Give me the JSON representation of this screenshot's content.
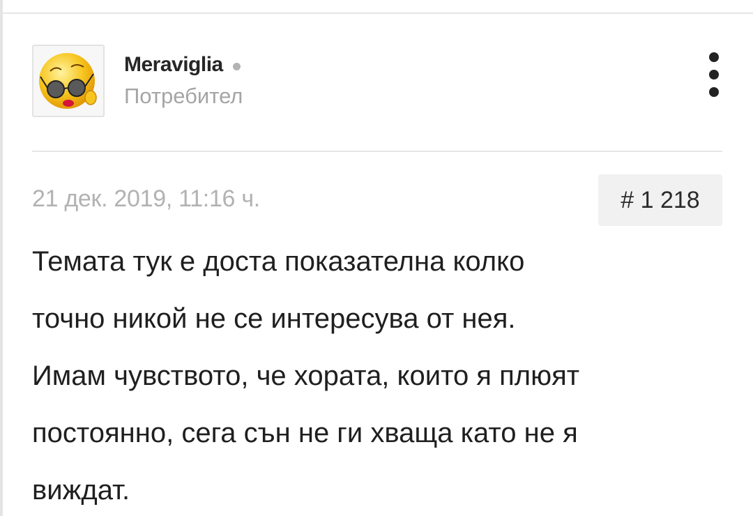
{
  "author": {
    "name": "Meraviglia",
    "role": "Потребител",
    "avatar_icon": "winking-emoji-with-sunglasses",
    "status_icon": "online-status-dot"
  },
  "menu": {
    "icon": "vertical-ellipsis-icon"
  },
  "post": {
    "date": "21 дек. 2019, 11:16 ч.",
    "number": "# 1 218",
    "lines": [
      "Темата тук е доста показателна колко",
      "точно никой не се интересува от нея.",
      "Имам чувството, че хората, които я плюят",
      "постоянно, сега сън не ги хваща като не я",
      "виждат."
    ]
  },
  "colors": {
    "divider": "#e6e6e6",
    "muted_text": "#a5a5a5",
    "body_text": "#1f1f1f",
    "badge_bg": "#f1f1f1",
    "status_dot": "#b3b3b3"
  }
}
